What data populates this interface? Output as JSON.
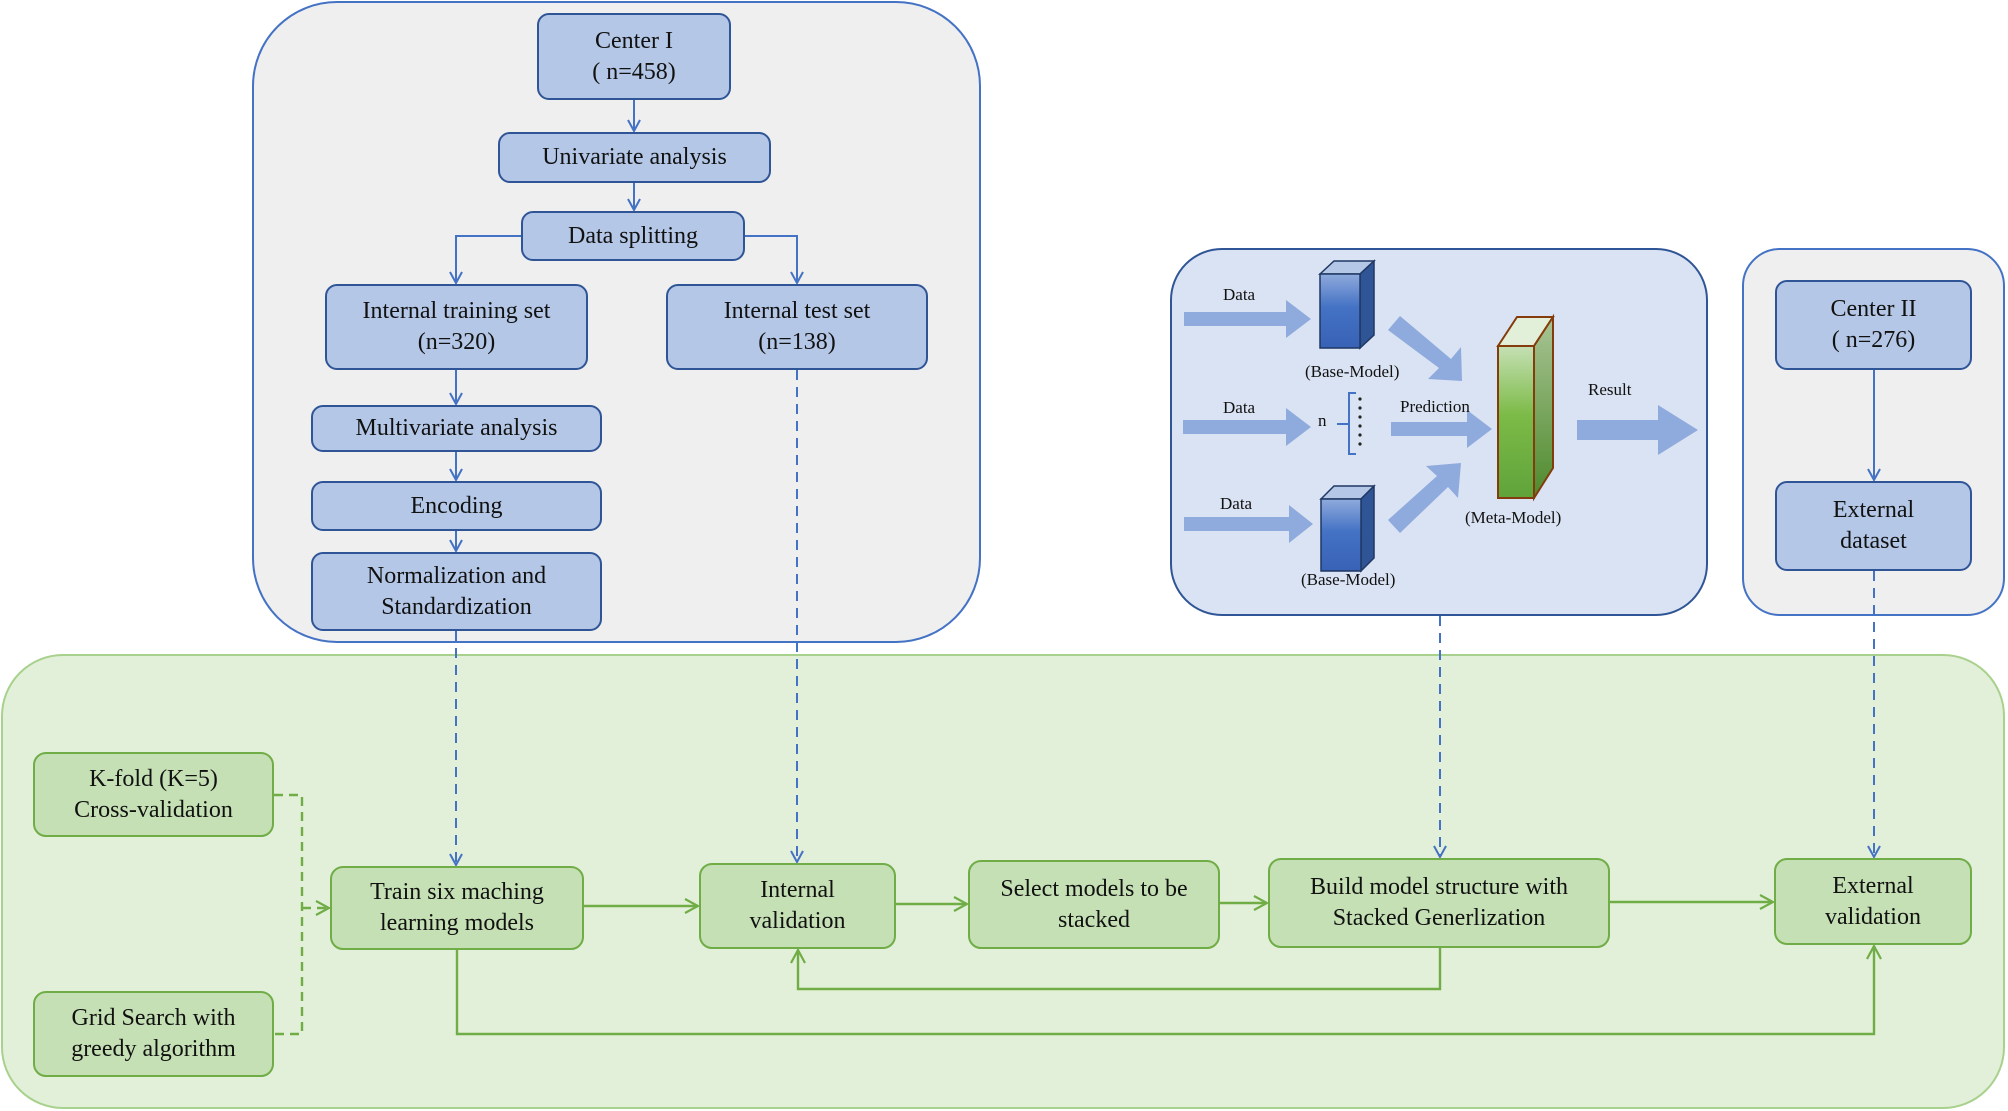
{
  "diagram": {
    "data_preparation": {
      "center_1": {
        "title": "Center I",
        "count": "( n=458)"
      },
      "univariate": "Univariate analysis",
      "data_splitting": "Data splitting",
      "training_set": {
        "title": "Internal training set",
        "count": "(n=320)"
      },
      "test_set": {
        "title": "Internal test set",
        "count": "(n=138)"
      },
      "multivariate": "Multivariate analysis",
      "encoding": "Encoding",
      "normalization": {
        "line1": "Normalization and",
        "line2": "Standardization"
      }
    },
    "stacking_schematic": {
      "data_labels": [
        "Data",
        "Data",
        "Data"
      ],
      "base_model_labels": [
        "(Base-Model)",
        "(Base-Model)"
      ],
      "n_label": "n",
      "prediction_label": "Prediction",
      "meta_model_label": "(Meta-Model)",
      "result_label": "Result"
    },
    "external_data": {
      "center_2": {
        "title": "Center II",
        "count": "( n=276)"
      },
      "external_dataset": {
        "line1": "External",
        "line2": "dataset"
      }
    },
    "modeling": {
      "kfold": {
        "line1": "K-fold (K=5)",
        "line2": "Cross-validation"
      },
      "grid_search": {
        "line1": "Grid Search with",
        "line2": "greedy algorithm"
      },
      "train_models": {
        "line1": "Train six maching",
        "line2": "learning models"
      },
      "internal_validation": {
        "line1": "Internal",
        "line2": "validation"
      },
      "select_models": {
        "line1": "Select models to be",
        "line2": "stacked"
      },
      "build_model": {
        "line1": "Build model structure with",
        "line2": "Stacked Generlization"
      },
      "external_validation": {
        "line1": "External",
        "line2": "validation"
      }
    },
    "colors": {
      "blue_line": "#4472c4",
      "blue_box": "#b4c7e7",
      "green_line": "#70ad47",
      "green_box": "#c5e0b4",
      "arrow_fill": "#8faadc",
      "base_model": "#4472c4",
      "meta_model": "#70ad47"
    }
  }
}
